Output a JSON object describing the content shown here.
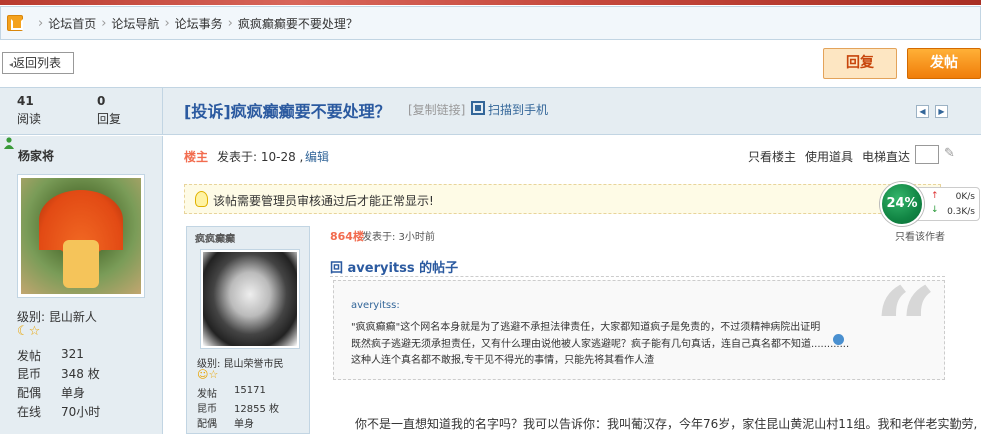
{
  "breadcrumb": {
    "items": [
      "论坛首页",
      "论坛导航",
      "论坛事务",
      "疯疯癫癫要不要处理？"
    ]
  },
  "toolbar": {
    "back_label": "返回列表",
    "reply_label": "回复",
    "post_label": "发帖"
  },
  "thread": {
    "views": "41",
    "views_label": "阅读",
    "replies": "0",
    "replies_label": "回复",
    "title": "[投诉]疯疯癫癫要不要处理？",
    "copy_link": "[复制链接]",
    "scan_label": "扫描到手机"
  },
  "author": {
    "name": "杨家将",
    "level": "级别: 昆山新人",
    "badges": "☾☆",
    "stats": [
      {
        "label": "发帖",
        "value": "321"
      },
      {
        "label": "昆币",
        "value": "348 枚"
      },
      {
        "label": "配偶",
        "value": "单身"
      },
      {
        "label": "在线",
        "value": "70小时"
      }
    ]
  },
  "post": {
    "floor_label": "楼主",
    "time": "发表于: 10-28 ,",
    "edit_label": "编辑",
    "only_floor": "只看楼主",
    "use_tool": "使用道具",
    "elevator": "电梯直达",
    "notice": "该帖需要管理员审核通过后才能正常显示!"
  },
  "gauge": {
    "percent": "24%",
    "up": "0K/s",
    "down": "0.3K/s"
  },
  "reply_card": {
    "name": "疯疯癫癫",
    "level": "级别: 昆山荣誉市民",
    "badge": "☺☆",
    "stats": [
      {
        "label": "发帖",
        "value": "15171"
      },
      {
        "label": "昆币",
        "value": "12855 枚"
      },
      {
        "label": "配偶",
        "value": "单身"
      }
    ]
  },
  "reply": {
    "floor": "864楼",
    "time": "发表于: 3小时前",
    "only_author": "只看该作者",
    "title": "回 averyitss 的帖子",
    "quote_author": "averyitss:",
    "quote_lines": [
      "\"疯疯癫癫\"这个网名本身就是为了逃避不承担法律责任，大家都知道疯子是免责的，不过须精神病院出证明",
      "既然疯子逃避无须承担责任，又有什么理由说他被人家逃避呢？疯子能有几句真话，连自己真名都不知道............",
      "这种人连个真名都不敢报,专干见不得光的事情，只能先将其看作人渣"
    ],
    "body": "你不是一直想知道我的名字吗？我可以告诉你：我叫葡汉存，今年76岁，家住昆山黄泥山村11组。我和老伴老实勤劳,"
  },
  "colors": {
    "accent_blue": "#2b5aa0",
    "orange": "#f07d0a",
    "floor_red": "#f26c4f",
    "panel_bg": "#e5edf2"
  }
}
